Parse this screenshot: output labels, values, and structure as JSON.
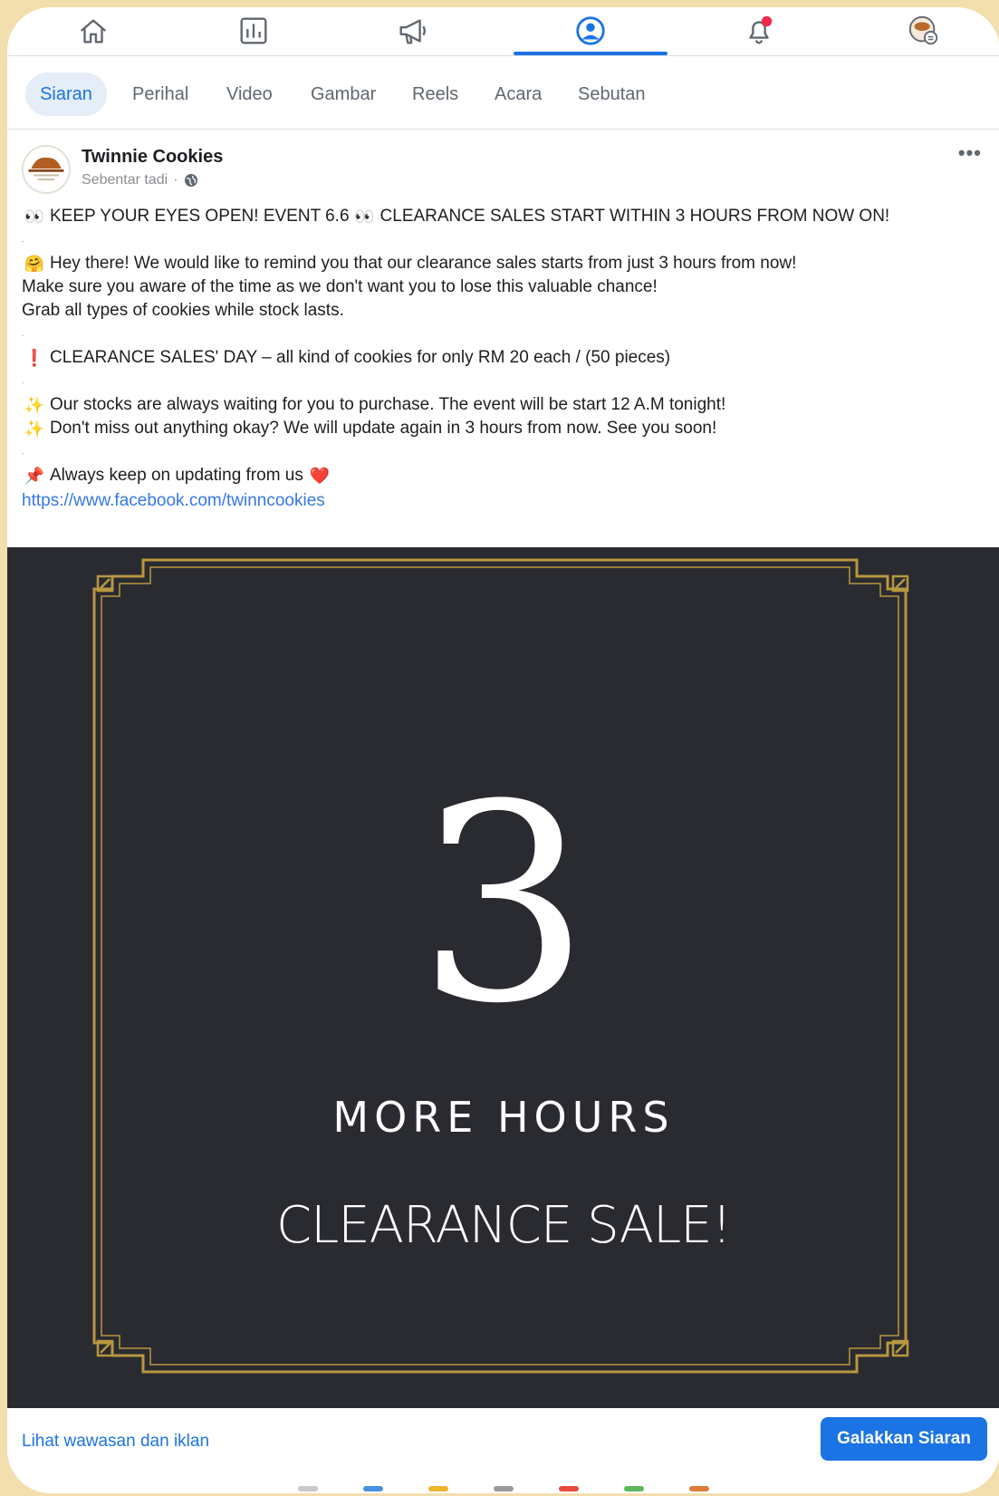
{
  "nav": {
    "icons": [
      "home-icon",
      "insights-icon",
      "megaphone-icon",
      "profile-icon",
      "notifications-icon",
      "menu-avatar-icon"
    ],
    "active": "profile-icon",
    "notification_badge_color": "#f02849"
  },
  "tabs": [
    {
      "label": "Siaran",
      "active": true
    },
    {
      "label": "Perihal",
      "active": false
    },
    {
      "label": "Video",
      "active": false
    },
    {
      "label": "Gambar",
      "active": false
    },
    {
      "label": "Reels",
      "active": false
    },
    {
      "label": "Acara",
      "active": false
    },
    {
      "label": "Sebutan",
      "active": false
    }
  ],
  "post": {
    "page_name": "Twinnie Cookies",
    "time": "Sebentar tadi",
    "privacy_icon": "globe-icon",
    "more_label": "•••",
    "lines": {
      "l1": "KEEP YOUR EYES OPEN! EVENT 6.6",
      "l1b": "CLEARANCE SALES START WITHIN 3 HOURS FROM NOW ON!",
      "l2": "Hey there! We would like to remind you that our clearance sales starts from just 3 hours from now!",
      "l3": "Make sure you aware of the time as we don't want you to lose this valuable chance!",
      "l4": "Grab all types of cookies while stock lasts.",
      "l5": "CLEARANCE SALES' DAY – all kind of cookies for only RM 20 each / (50 pieces)",
      "l6": "Our stocks are always waiting for you to purchase. The event will be start 12 A.M tonight!",
      "l7": "Don't miss out anything okay? We will update again in 3 hours from now. See you soon!",
      "l8": "Always keep on updating from us",
      "link": "https://www.facebook.com/twinncookies",
      "dot": "."
    },
    "emoji": {
      "eyes": "👀",
      "hug": "🤗",
      "exclaim": "❗",
      "sparkle": "✨",
      "pin": "📌",
      "heart": "❤️"
    },
    "image": {
      "number": "3",
      "line1": "MORE HOURS",
      "line2": "CLEARANCE SALE!",
      "background": "#2a2b31",
      "frame_color": "#b8973f"
    }
  },
  "footer": {
    "insights_label": "Lihat wawasan dan iklan",
    "boost_label": "Galakkan Siaran",
    "accent": "#1b74e4"
  }
}
